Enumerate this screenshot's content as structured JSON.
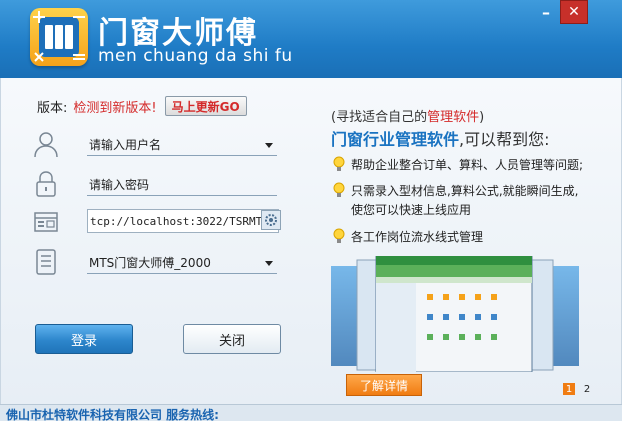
{
  "window": {
    "title_cn": "门窗大师傅",
    "title_pinyin": "men chuang da shi fu",
    "minimize_label": "–",
    "close_label": "✕"
  },
  "version": {
    "label": "版本:",
    "status": "检测到新版本!",
    "update_button": "马上更新GO"
  },
  "form": {
    "username": "请输入用户名",
    "password": "请输入密码",
    "server": "tcp://localhost:3022/TSRMT:",
    "database": "MTS门窗大师傅_2000",
    "login_button": "登录",
    "close_button": "关闭"
  },
  "promo": {
    "line1_prefix": "(寻找适合自己的",
    "line1_highlight": "管理软件",
    "line1_suffix": ")",
    "title_highlight": "门窗行业管理软件",
    "title_rest": ",可以帮到您:",
    "features": [
      "帮助企业整合订单、算料、人员管理等问题;",
      "只需录入型材信息,算料公式,就能瞬间生成,",
      "使您可以快速上线应用",
      "各工作岗位流水线式管理"
    ],
    "more_button": "了解详情",
    "pages": [
      "1",
      "2"
    ]
  },
  "footer": {
    "text": "佛山市杜特软件科技有限公司  服务热线:"
  },
  "colors": {
    "header": "#1f7cc6",
    "accent_red": "#d42a2a",
    "accent_orange": "#f07c12"
  }
}
